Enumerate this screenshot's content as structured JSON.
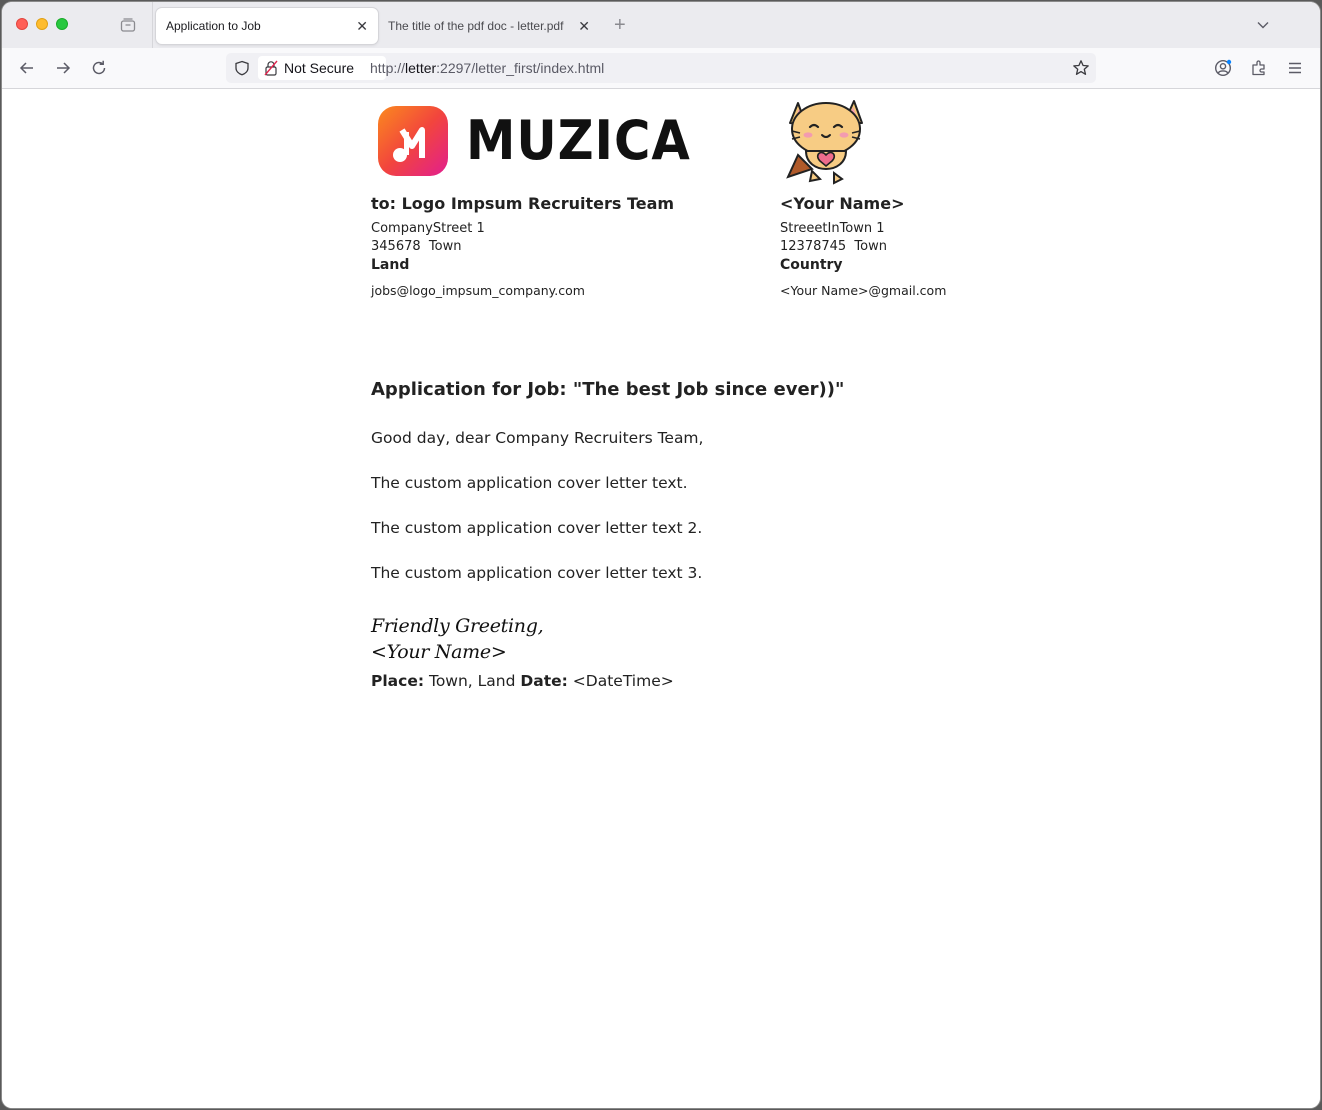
{
  "browser": {
    "tabs": [
      {
        "label": "Application to Job",
        "active": true
      },
      {
        "label": "The title of the pdf doc - letter.pdf",
        "active": false
      }
    ],
    "not_secure_label": "Not Secure",
    "url_prefix": "http://",
    "url_host": "letter",
    "url_rest": ":2297/letter_first/index.html"
  },
  "letter": {
    "logo_text": "MUZICA",
    "recipient": {
      "heading": "to: Logo Impsum Recruiters Team",
      "street": "CompanyStreet 1",
      "city": "345678  Town",
      "country": "Land",
      "email": "jobs@logo_impsum_company.com"
    },
    "sender": {
      "heading": "<Your Name>",
      "street": "StreeetInTown 1",
      "city": "12378745  Town",
      "country": "Country",
      "email": "<Your Name>@gmail.com"
    },
    "subject": "Application for Job: \"The best Job since ever))\"",
    "greeting": "Good day, dear Company Recruiters Team,",
    "paragraphs": [
      "The custom application cover letter text.",
      "The custom application cover letter text 2.",
      "The custom application cover letter text 3."
    ],
    "closing": "Friendly Greeting,",
    "signature": "<Your Name>",
    "place_label": "Place:",
    "place_value": "Town, Land",
    "date_label": "Date:",
    "date_value": "<DateTime>"
  },
  "colors": {
    "logo_gradient": [
      "#fb8a1e",
      "#f2453d",
      "#e21e8f"
    ],
    "close_red": "#ff5f57",
    "minimize_yellow": "#febc2e",
    "zoom_green": "#28c840"
  }
}
